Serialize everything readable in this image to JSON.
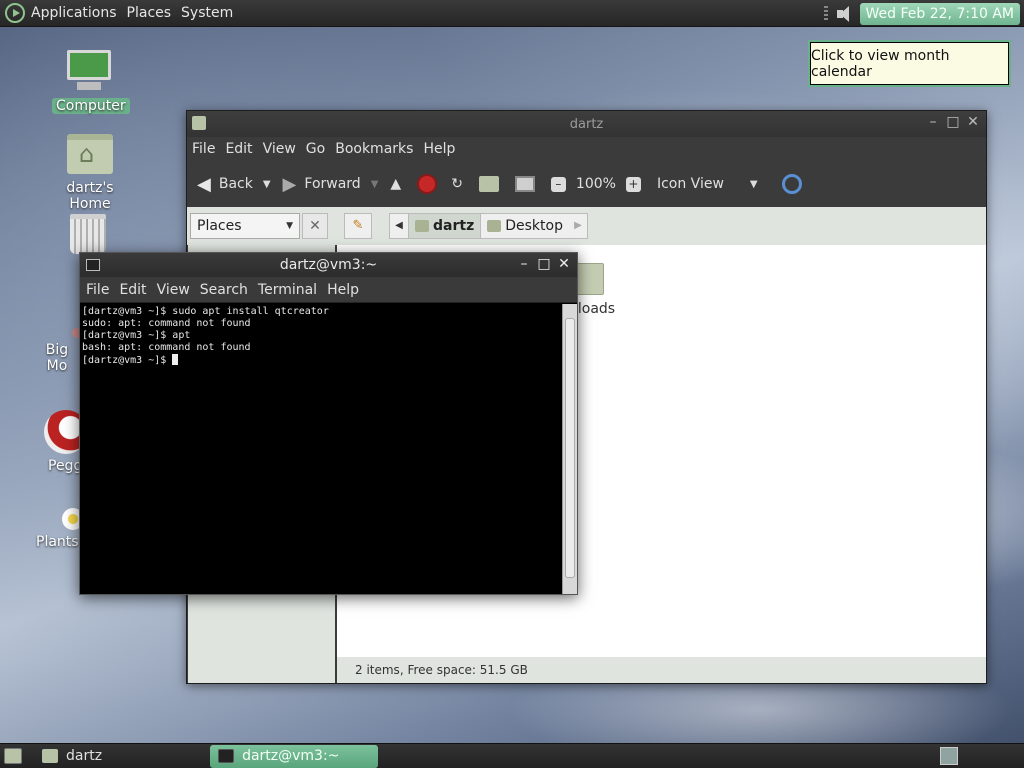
{
  "top_panel": {
    "menus": [
      "Applications",
      "Places",
      "System"
    ],
    "clock": "Wed Feb 22,  7:10 AM"
  },
  "tooltip": "Click to view month calendar",
  "desktop_icons": {
    "computer": "Computer",
    "home": "dartz's Home",
    "trash": "T",
    "big": "Big Mo",
    "pegg": "Pegg",
    "plants": "Plants"
  },
  "file_manager": {
    "title": "dartz",
    "menu": [
      "File",
      "Edit",
      "View",
      "Go",
      "Bookmarks",
      "Help"
    ],
    "toolbar": {
      "back": "Back",
      "forward": "Forward",
      "zoom": "100%",
      "view_mode": "Icon View"
    },
    "places_label": "Places",
    "breadcrumbs": [
      "dartz",
      "Desktop"
    ],
    "items": [
      "nloads"
    ],
    "status": "2 items, Free space: 51.5 GB"
  },
  "terminal": {
    "title": "dartz@vm3:~",
    "menu": [
      "File",
      "Edit",
      "View",
      "Search",
      "Terminal",
      "Help"
    ],
    "lines": [
      "[dartz@vm3 ~]$ sudo apt install qtcreator",
      "sudo: apt: command not found",
      "[dartz@vm3 ~]$ apt",
      "bash: apt: command not found",
      "[dartz@vm3 ~]$ "
    ]
  },
  "taskbar": {
    "tasks": [
      "dartz",
      "dartz@vm3:~"
    ]
  },
  "colors": {
    "accent": "#6ab08a",
    "panel": "#2c2c2c",
    "stop": "#c62828"
  }
}
